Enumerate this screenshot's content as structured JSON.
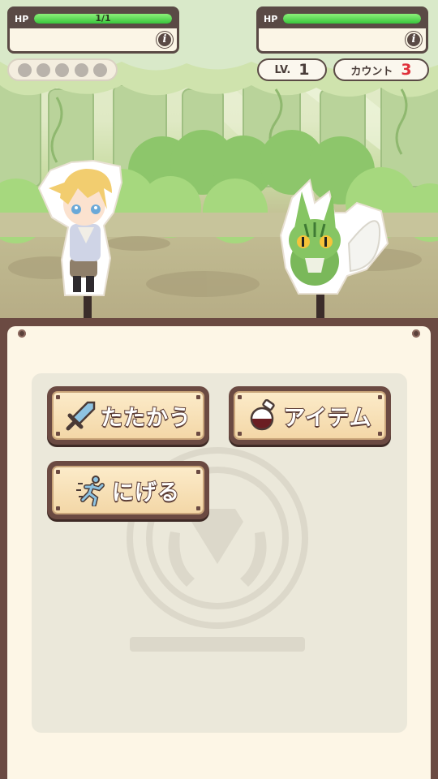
{
  "player": {
    "hp_label": "HP",
    "hp_text": "1/1",
    "hp_fraction": 1.0,
    "info_label": "i"
  },
  "enemy": {
    "hp_label": "HP",
    "hp_fraction": 1.0,
    "info_label": "i",
    "level_label": "LV.",
    "level_value": "1",
    "count_label": "カウント",
    "count_value": "3"
  },
  "turn_dots": {
    "count": 5
  },
  "commands": {
    "fight_label": "たたかう",
    "item_label": "アイテム",
    "escape_label": "にげる"
  },
  "colors": {
    "hp_green": "#38c63c",
    "frame_brown": "#5a4a45",
    "count_red": "#e0303a"
  },
  "icons": {
    "fight": "sword-icon",
    "item": "potion-icon",
    "escape": "running-man-icon",
    "info": "info-icon"
  }
}
